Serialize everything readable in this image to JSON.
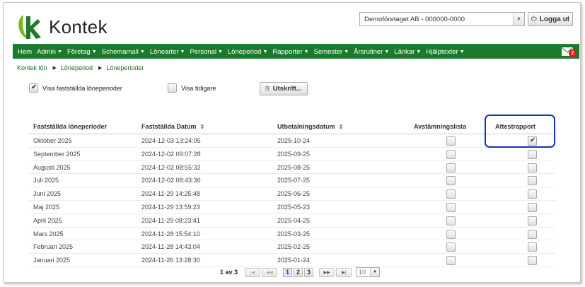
{
  "brand": {
    "name": "Kontek",
    "green": "#1c7a2f"
  },
  "header": {
    "company": "Demoföretaget AB - 000000-0000",
    "logout_label": "Logga ut"
  },
  "nav": {
    "items": [
      "Hem",
      "Admin",
      "Företag",
      "Schemamall",
      "Lönearter",
      "Personal",
      "Löneperiod",
      "Rapporter",
      "Semester",
      "Årsrutiner",
      "Länkar",
      "Hjälptexter"
    ],
    "has_dropdown": [
      false,
      true,
      true,
      true,
      true,
      true,
      true,
      true,
      true,
      true,
      true,
      true
    ],
    "mail_badge": "2"
  },
  "breadcrumb": [
    "Kontek lön",
    "Löneperiod",
    "Löneperioder"
  ],
  "options": {
    "show_fixed_label": "Visa fastställda löneperioder",
    "show_fixed_checked": true,
    "show_earlier_label": "Visa tidigare",
    "show_earlier_checked": false,
    "print_label": "Utskrift..."
  },
  "table": {
    "columns": {
      "period": "Fastställda löneperioder",
      "date": "Fastställda Datum",
      "pay": "Utbetalningsdatum",
      "avst": "Avstämningslista",
      "att": "Attestrapport"
    },
    "rows": [
      {
        "period": "Oktober 2025",
        "date": "2024-12-03 13:24:05",
        "pay": "2025-10-24",
        "avst": false,
        "att": true
      },
      {
        "period": "September 2025",
        "date": "2024-12-02 09:07:28",
        "pay": "2025-09-25",
        "avst": false,
        "att": false
      },
      {
        "period": "Augusti 2025",
        "date": "2024-12-02 08:55:32",
        "pay": "2025-08-25",
        "avst": false,
        "att": false
      },
      {
        "period": "Juli 2025",
        "date": "2024-12-02 08:43:36",
        "pay": "2025-07-25",
        "avst": false,
        "att": false
      },
      {
        "period": "Juni 2025",
        "date": "2024-11-29 14:25:48",
        "pay": "2025-06-25",
        "avst": false,
        "att": false
      },
      {
        "period": "Maj 2025",
        "date": "2024-11-29 13:59:23",
        "pay": "2025-05-23",
        "avst": false,
        "att": false
      },
      {
        "period": "April 2025",
        "date": "2024-11-29 08:23:41",
        "pay": "2025-04-25",
        "avst": false,
        "att": false
      },
      {
        "period": "Mars 2025",
        "date": "2024-11-28 15:54:10",
        "pay": "2025-03-25",
        "avst": false,
        "att": false
      },
      {
        "period": "Februari 2025",
        "date": "2024-11-28 14:43:04",
        "pay": "2025-02-25",
        "avst": false,
        "att": false
      },
      {
        "period": "Januari 2025",
        "date": "2024-11-26 13:28:30",
        "pay": "2025-01-24",
        "avst": false,
        "att": false
      }
    ]
  },
  "pager": {
    "info": "1 av 3",
    "pages": [
      "1",
      "2",
      "3"
    ],
    "active_page": "1",
    "page_size": "10"
  },
  "annotation_color": "#1c2fc2"
}
